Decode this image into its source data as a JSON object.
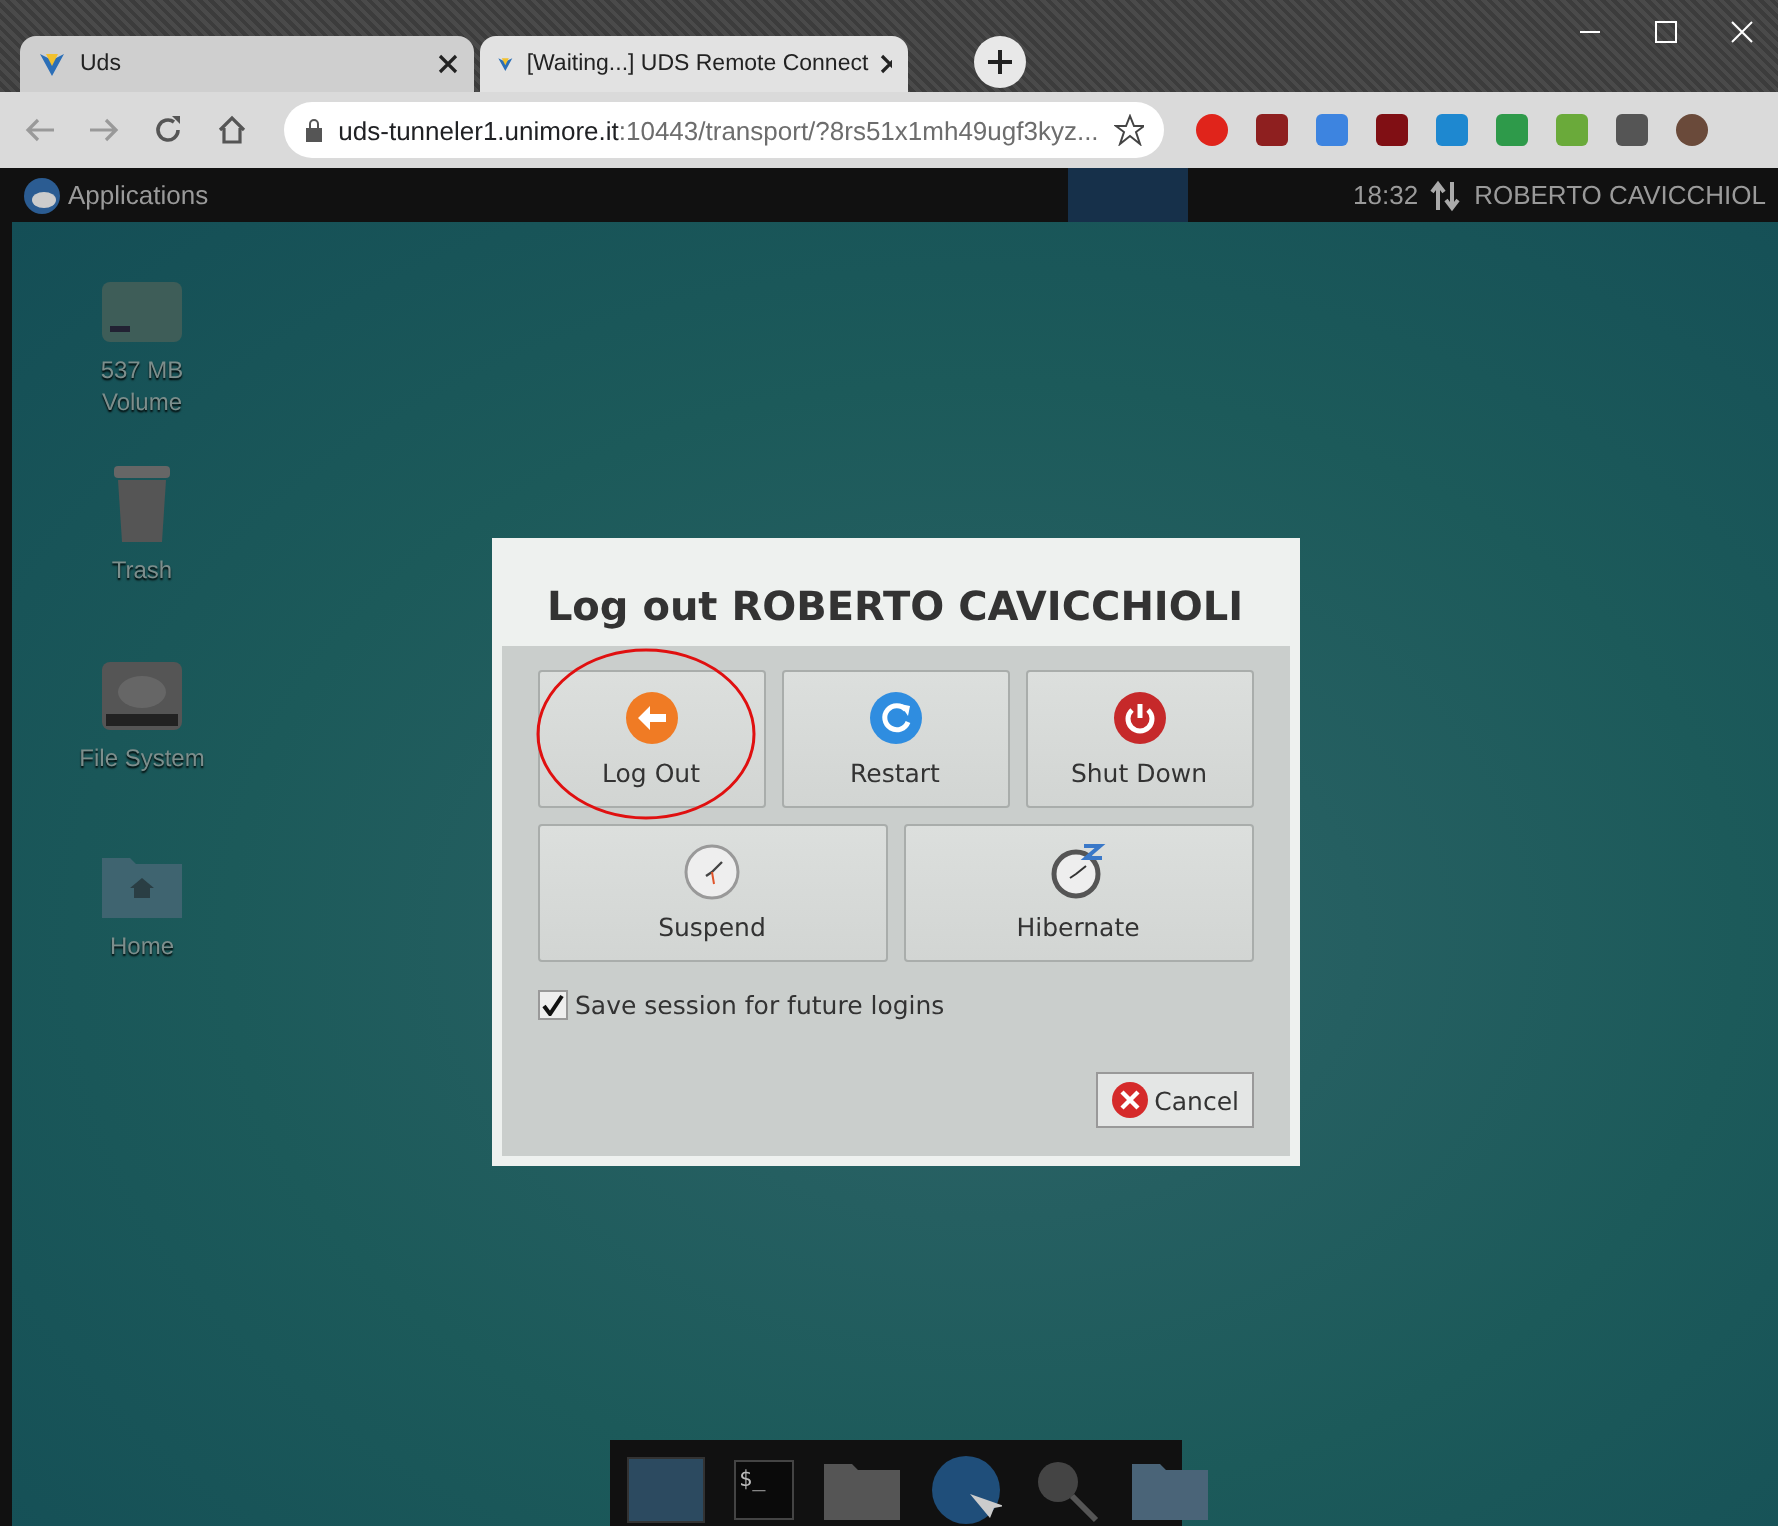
{
  "browser": {
    "tabs": [
      {
        "title": "Uds",
        "selected": false
      },
      {
        "title": "[Waiting...] UDS Remote Connect",
        "selected": true
      }
    ],
    "address": {
      "host": "uds-tunneler1.unimore.it",
      "path": ":10443/transport/?8rs51x1mh49ugf3kyz..."
    }
  },
  "panel": {
    "menu": "Applications",
    "clock": "18:32",
    "user": "ROBERTO CAVICCHIOL"
  },
  "desktop_icons": [
    {
      "kind": "drive",
      "label": "537 MB Volume"
    },
    {
      "kind": "trash",
      "label": "Trash"
    },
    {
      "kind": "disk",
      "label": "File System"
    },
    {
      "kind": "home",
      "label": "Home"
    }
  ],
  "dialog": {
    "title": "Log out ROBERTO CAVICCHIOLI",
    "actions": [
      {
        "kind": "logout",
        "label": "Log Out",
        "circled": true
      },
      {
        "kind": "restart",
        "label": "Restart",
        "circled": false
      },
      {
        "kind": "shutdown",
        "label": "Shut Down",
        "circled": false
      },
      {
        "kind": "suspend",
        "label": "Suspend",
        "circled": false
      },
      {
        "kind": "hibernate",
        "label": "Hibernate",
        "circled": false
      }
    ],
    "save_session": {
      "label": "Save session for future logins",
      "checked": true
    },
    "cancel": "Cancel"
  },
  "dock": [
    {
      "kind": "window"
    },
    {
      "kind": "terminal",
      "text": "$_"
    },
    {
      "kind": "home"
    },
    {
      "kind": "globe"
    },
    {
      "kind": "search"
    },
    {
      "kind": "folder"
    }
  ]
}
